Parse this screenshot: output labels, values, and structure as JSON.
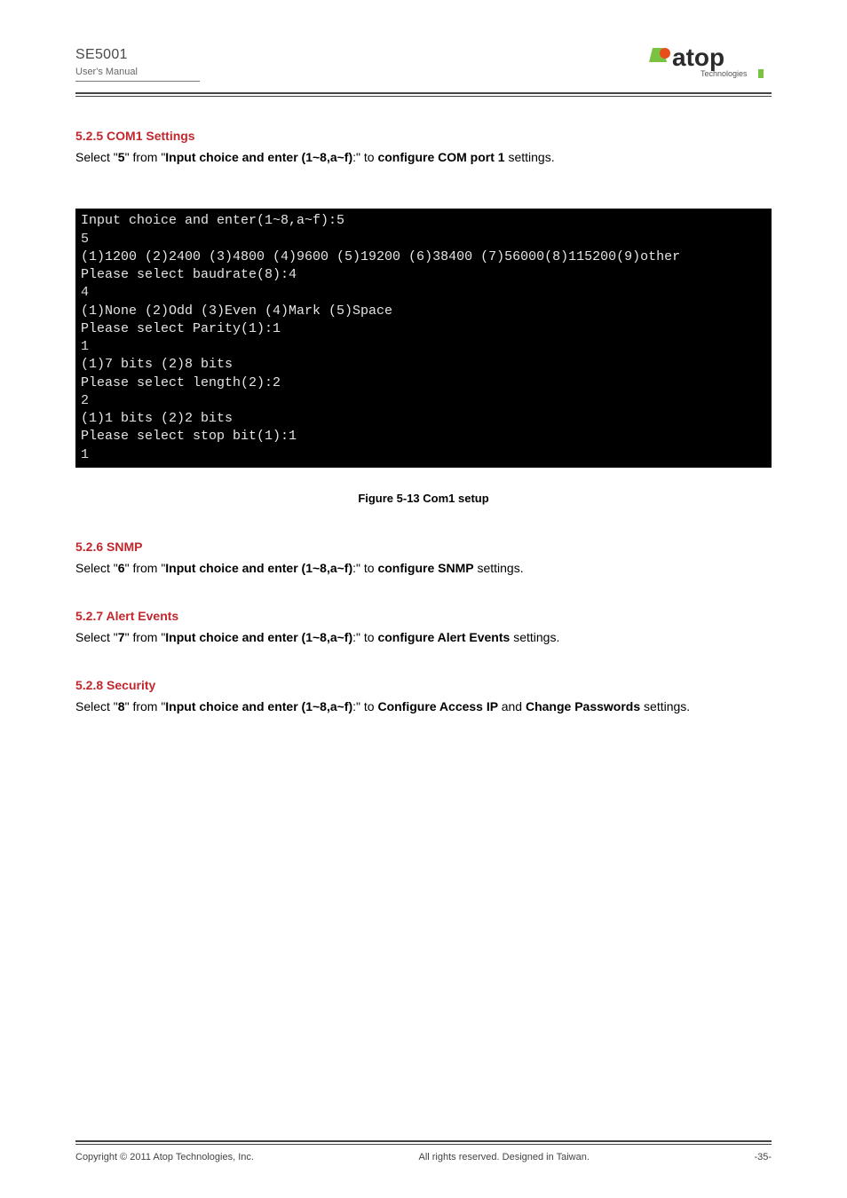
{
  "header": {
    "product": "SE5001",
    "label": "User's Manual"
  },
  "logo": {
    "brand": "atop",
    "sub": "Technologies"
  },
  "section1": {
    "heading": "5.2.5 COM1 Settings",
    "line_pre": "Select \"",
    "line_opt": "5",
    "line_mid": "\" from \"",
    "line_prompt": "Input choice and enter (1~8,a~f)",
    "line_post": ":\" to ",
    "line_action_bold": "configure COM port 1",
    "line_action_post": " settings.",
    "figure_caption": "Figure 5-13 Com1 setup"
  },
  "terminal": {
    "l1": "Input choice and enter(1~8,a~f):5",
    "l2": "5",
    "l3": "(1)1200 (2)2400 (3)4800 (4)9600 (5)19200 (6)38400 (7)56000(8)115200(9)other",
    "l4": "Please select baudrate(8):4",
    "l5": "4",
    "l6": "(1)None (2)Odd (3)Even (4)Mark (5)Space",
    "l7": "Please select Parity(1):1",
    "l8": "1",
    "l9": "(1)7 bits (2)8 bits",
    "l10": "Please select length(2):2",
    "l11": "2",
    "l12": "(1)1 bits (2)2 bits",
    "l13": "Please select stop bit(1):1",
    "l14": "1"
  },
  "section2": {
    "heading": "5.2.6 SNMP",
    "line_pre": "Select \"",
    "line_opt": "6",
    "line_mid": "\" from \"",
    "line_prompt": "Input choice and enter (1~8,a~f)",
    "line_post": ":\" to ",
    "line_action_bold": "configure SNMP",
    "line_action_post": " settings."
  },
  "section3": {
    "heading": "5.2.7 Alert Events",
    "line_pre": "Select \"",
    "line_opt": "7",
    "line_mid": "\" from \"",
    "line_prompt": "Input choice and enter (1~8,a~f)",
    "line_post": ":\" to ",
    "line_action_bold": "configure Alert Events",
    "line_action_post": " settings."
  },
  "section4": {
    "heading": "5.2.8 Security",
    "line_pre": "Select \"",
    "line_opt": "8",
    "line_mid": "\" from \"",
    "line_prompt": "Input choice and enter (1~8,a~f)",
    "line_post": ":\" to ",
    "line_action_bold": "Configure Access IP ",
    "line_action_post": "and ",
    "line_action_bold2": "Change Passwords",
    "line_action_post2": " settings."
  },
  "footer": {
    "left": "Copyright © 2011 Atop Technologies, Inc.",
    "center": "All rights reserved. Designed in Taiwan.",
    "right": "-35-"
  }
}
